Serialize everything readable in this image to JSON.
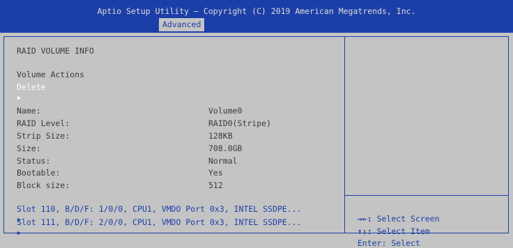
{
  "header": {
    "title": "Aptio Setup Utility – Copyright (C) 2019 American Megatrends, Inc.",
    "active_tab": "Advanced"
  },
  "main": {
    "section_title": "RAID VOLUME INFO",
    "volume_actions_label": "Volume Actions",
    "delete_label": "Delete",
    "fields": [
      {
        "label": "Name:",
        "value": "Volume0"
      },
      {
        "label": "RAID Level:",
        "value": "RAID0(Stripe)"
      },
      {
        "label": "Strip Size:",
        "value": "128KB"
      },
      {
        "label": "Size:",
        "value": "708.0GB"
      },
      {
        "label": "Status:",
        "value": "Normal"
      },
      {
        "label": "Bootable:",
        "value": "Yes"
      },
      {
        "label": "Block size:",
        "value": "512"
      }
    ],
    "slots": [
      "Slot 110, B/D/F: 1/0/0, CPU1, VMDO Port 0x3, INTEL SSDPE...",
      "Slot 111, B/D/F: 2/0/0, CPU1, VMDO Port 0x3, INTEL SSDPE..."
    ],
    "submenu_arrow": "▶"
  },
  "help": {
    "items": [
      {
        "key": "→←:",
        "text": " Select Screen"
      },
      {
        "key": "↑↓:",
        "text": " Select Item"
      },
      {
        "key": "Enter:",
        "text": " Select"
      }
    ]
  },
  "colors": {
    "header_bg": "#1c3fa7",
    "page_bg": "#c4c4c4",
    "highlight_text": "#ffffff",
    "accent_text": "#1c3fa7"
  }
}
